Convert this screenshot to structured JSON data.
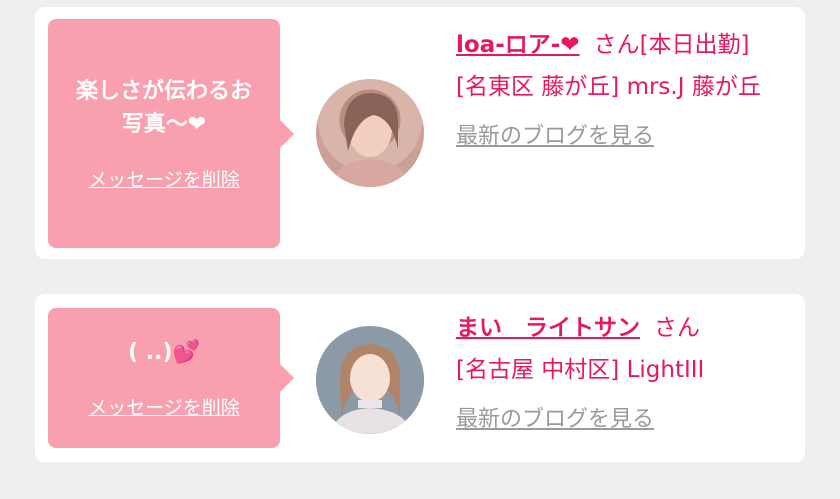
{
  "messages": [
    {
      "bubble_text": "楽しさが伝わるお\n写真〜❤",
      "delete_label": "メッセージを削除",
      "name": "loa-ロア-❤",
      "honorific": "さん[本日出勤]",
      "shop": "[名東区 藤が丘] mrs.J 藤が丘",
      "blog_link": "最新のブログを見る"
    },
    {
      "bubble_text": "( ..)💕",
      "delete_label": "メッセージを削除",
      "name": "まい　ライトサン",
      "honorific": "さん",
      "shop": "[名古屋 中村区] LightIII",
      "blog_link": "最新のブログを見る"
    }
  ],
  "colors": {
    "accent": "#e8195a",
    "bubble": "#f8a0b0",
    "link_gray": "#9a9a9a",
    "background": "#efefef"
  },
  "icons": [
    "avatar-photo"
  ]
}
